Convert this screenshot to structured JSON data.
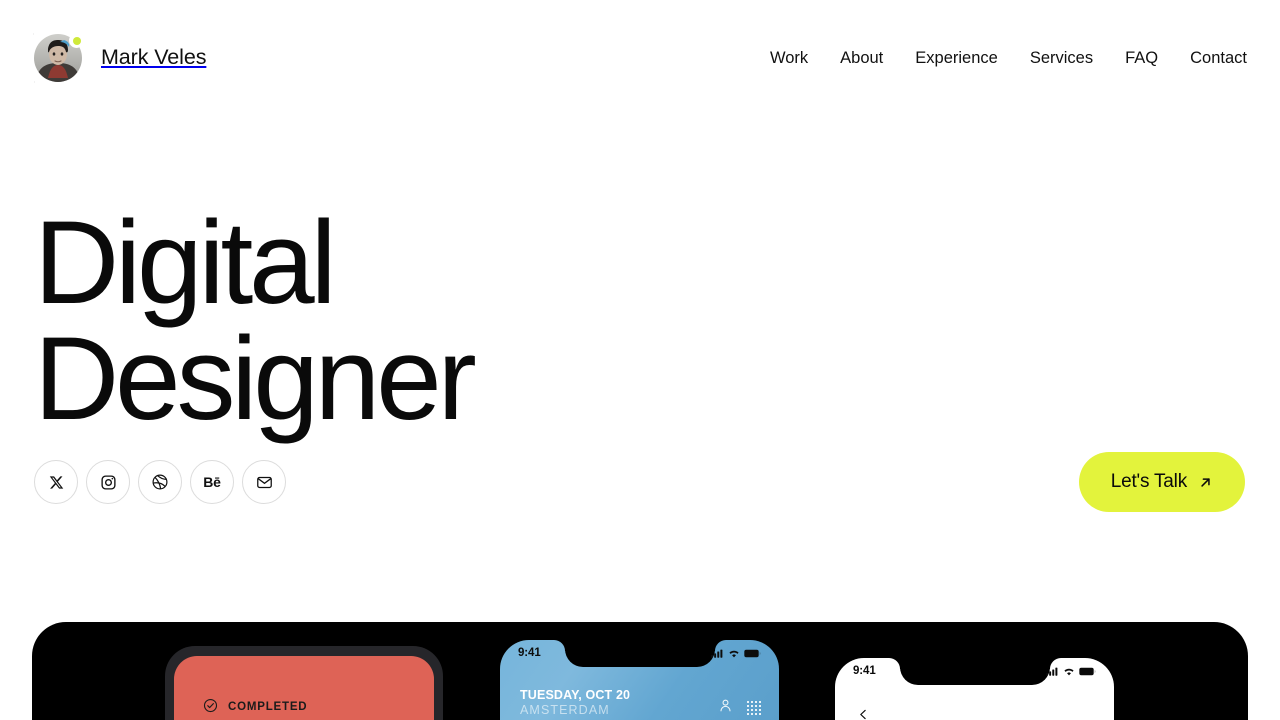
{
  "header": {
    "brand_name": "Mark Veles",
    "avatar_name": "profile-photo",
    "status_badge_color": "#cfe93a",
    "nav": [
      {
        "label": "Work"
      },
      {
        "label": "About"
      },
      {
        "label": "Experience"
      },
      {
        "label": "Services"
      },
      {
        "label": "FAQ"
      },
      {
        "label": "Contact"
      }
    ]
  },
  "hero": {
    "title_line_1": "Digital",
    "title_line_2": "Designer",
    "socials": [
      {
        "name": "x-twitter-icon",
        "label": "X"
      },
      {
        "name": "instagram-icon",
        "label": "Instagram"
      },
      {
        "name": "dribbble-icon",
        "label": "Dribbble"
      },
      {
        "name": "behance-icon",
        "label": "Bē"
      },
      {
        "name": "email-icon",
        "label": "Email"
      }
    ],
    "cta": {
      "label": "Let's Talk",
      "icon": "arrow-up-right-icon",
      "background": "#e3f33c"
    }
  },
  "showcase": {
    "background": "#000000",
    "phone_1": {
      "card_color": "#de6356",
      "status_label": "COMPLETED",
      "status_icon": "check-circle-icon"
    },
    "phone_2": {
      "time": "9:41",
      "day": "TUESDAY, OCT 20",
      "city": "AMSTERDAM",
      "screen_color": "#6aaad4",
      "actions": [
        "person-icon",
        "keypad-grid-icon"
      ],
      "status_icons": [
        "cellular-signal-icon",
        "wifi-icon",
        "battery-icon"
      ]
    },
    "phone_3": {
      "time": "9:41",
      "screen_color": "#ffffff",
      "back_icon": "chevron-left-icon",
      "status_icons": [
        "cellular-signal-icon",
        "wifi-icon",
        "battery-icon"
      ]
    }
  }
}
